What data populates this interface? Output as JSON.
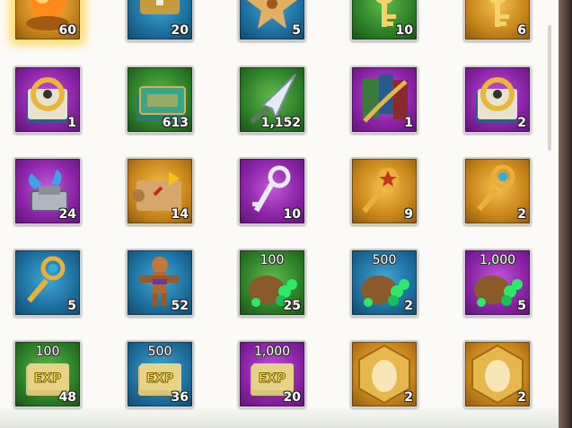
{
  "items": [
    {
      "name": "inventory-item-orange-orb",
      "color": "gold",
      "icon": "orange-orb-icon",
      "count": "60",
      "amount": "",
      "highlighted": true
    },
    {
      "name": "inventory-item-chest",
      "color": "blue",
      "icon": "chest-icon",
      "count": "20",
      "amount": ""
    },
    {
      "name": "inventory-item-relic",
      "color": "blue",
      "icon": "relic-icon",
      "count": "5",
      "amount": ""
    },
    {
      "name": "inventory-item-key-green",
      "color": "green",
      "icon": "key-icon",
      "count": "10",
      "amount": ""
    },
    {
      "name": "inventory-item-key-gold",
      "color": "gold",
      "icon": "key-icon",
      "count": "6",
      "amount": ""
    },
    {
      "name": "inventory-item-lock-tome",
      "color": "purple",
      "icon": "locked-book-icon",
      "count": "1",
      "amount": ""
    },
    {
      "name": "inventory-item-green-tome",
      "color": "green",
      "icon": "tome-icon",
      "count": "613",
      "amount": ""
    },
    {
      "name": "inventory-item-spearhead",
      "color": "green",
      "icon": "spearhead-icon",
      "count": "1,152",
      "amount": ""
    },
    {
      "name": "inventory-item-scroll-banners",
      "color": "purple",
      "icon": "banners-icon",
      "count": "1",
      "amount": ""
    },
    {
      "name": "inventory-item-purple-lock-tome",
      "color": "purple",
      "icon": "locked-book-icon",
      "count": "2",
      "amount": ""
    },
    {
      "name": "inventory-item-blue-tools",
      "color": "purple",
      "icon": "tools-icon",
      "count": "24",
      "amount": ""
    },
    {
      "name": "inventory-item-map-scroll",
      "color": "gold",
      "icon": "map-scroll-icon",
      "count": "14",
      "amount": ""
    },
    {
      "name": "inventory-item-silver-key",
      "color": "purple",
      "icon": "silver-key-icon",
      "count": "10",
      "amount": ""
    },
    {
      "name": "inventory-item-gold-star-key",
      "color": "gold",
      "icon": "star-key-icon",
      "count": "9",
      "amount": ""
    },
    {
      "name": "inventory-item-gold-gem-key",
      "color": "gold",
      "icon": "gem-key-icon",
      "count": "2",
      "amount": ""
    },
    {
      "name": "inventory-item-purple-gem-key",
      "color": "blue",
      "icon": "gem-key-icon",
      "count": "5",
      "amount": ""
    },
    {
      "name": "inventory-item-voodoo-doll",
      "color": "blue",
      "icon": "doll-icon",
      "count": "52",
      "amount": ""
    },
    {
      "name": "inventory-item-gem-sack-100",
      "color": "green",
      "icon": "gem-sack-icon",
      "count": "25",
      "amount": "100"
    },
    {
      "name": "inventory-item-gem-sack-500",
      "color": "blue",
      "icon": "gem-sack-icon",
      "count": "2",
      "amount": "500"
    },
    {
      "name": "inventory-item-gem-sack-1000",
      "color": "purple",
      "icon": "gem-sack-icon",
      "count": "5",
      "amount": "1,000"
    },
    {
      "name": "inventory-item-exp-book-100",
      "color": "green",
      "icon": "exp-book-icon",
      "count": "48",
      "amount": "100"
    },
    {
      "name": "inventory-item-exp-book-500",
      "color": "blue",
      "icon": "exp-book-icon",
      "count": "36",
      "amount": "500"
    },
    {
      "name": "inventory-item-exp-book-1000",
      "color": "purple",
      "icon": "exp-book-icon",
      "count": "20",
      "amount": "1,000"
    },
    {
      "name": "inventory-item-gold-portrait-1",
      "color": "gold",
      "icon": "portrait-icon",
      "count": "2",
      "amount": ""
    },
    {
      "name": "inventory-item-gold-portrait-2",
      "color": "gold",
      "icon": "portrait-icon",
      "count": "2",
      "amount": ""
    }
  ]
}
